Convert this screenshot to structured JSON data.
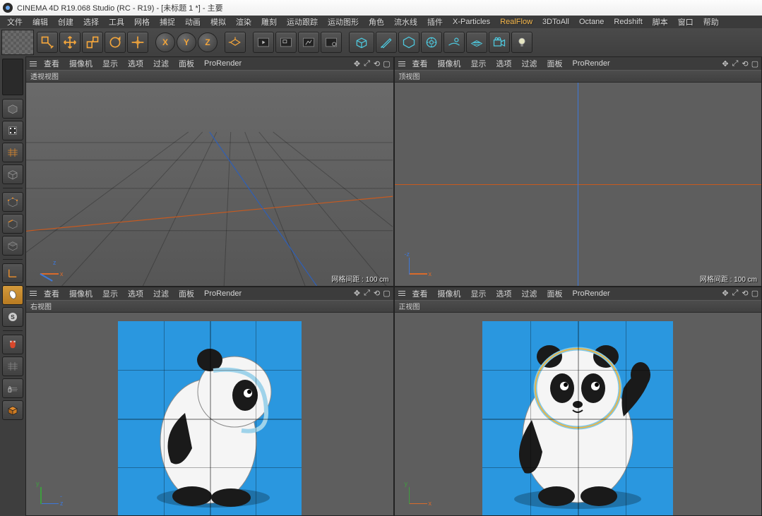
{
  "title": "CINEMA 4D R19.068 Studio (RC - R19) - [未标题 1 *] - 主要",
  "menu": {
    "items": [
      "文件",
      "编辑",
      "创建",
      "选择",
      "工具",
      "网格",
      "捕捉",
      "动画",
      "模拟",
      "渲染",
      "雕刻",
      "运动跟踪",
      "运动图形",
      "角色",
      "流水线",
      "插件",
      "X-Particles",
      "RealFlow",
      "3DToAll",
      "Octane",
      "Redshift",
      "脚本",
      "窗口",
      "帮助"
    ],
    "highlight": "RealFlow"
  },
  "toolbar": {
    "axes": [
      "X",
      "Y",
      "Z"
    ]
  },
  "viewport_menu": [
    "查看",
    "摄像机",
    "显示",
    "选项",
    "过滤",
    "面板",
    "ProRender"
  ],
  "viewports": {
    "tl": {
      "label": "透视视图",
      "info": "网格间距 : 100 cm",
      "axes": {
        "x": "x",
        "z": "z"
      }
    },
    "tr": {
      "label": "顶视图",
      "info": "网格间距 : 100 cm",
      "axes": {
        "x": "x",
        "z": "-z"
      }
    },
    "bl": {
      "label": "右视图",
      "axes": {
        "z": "-z",
        "y": "y"
      }
    },
    "br": {
      "label": "正视图",
      "axes": {
        "x": "x",
        "y": "y"
      }
    }
  }
}
